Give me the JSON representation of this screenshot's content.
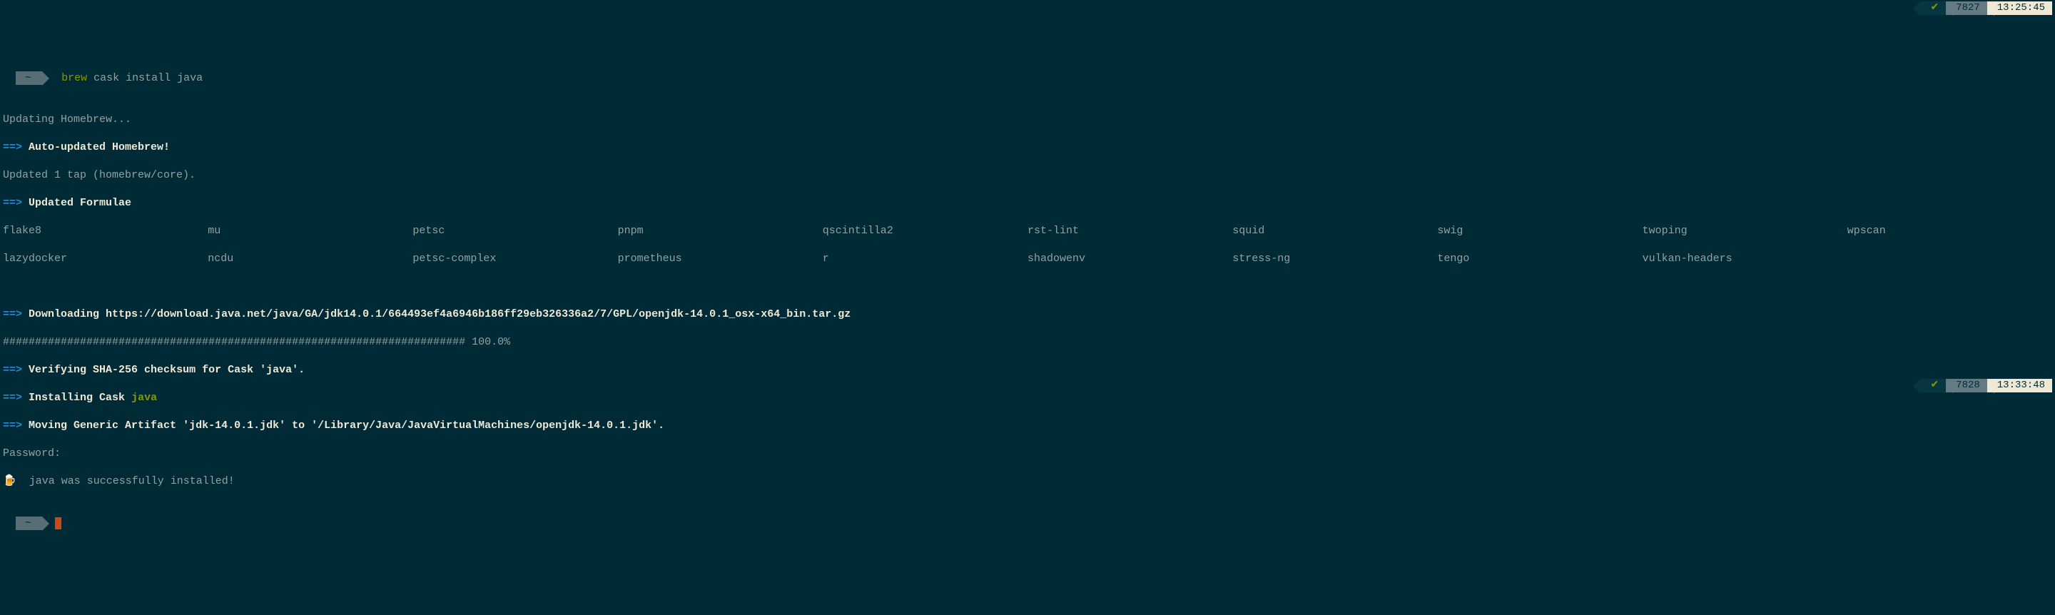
{
  "prompt": {
    "symbol": "~",
    "cmd_first": "brew",
    "cmd_rest": "cask install java"
  },
  "status1": {
    "check": "✔",
    "num": "7827",
    "time": "13:25:45"
  },
  "status2": {
    "check": "✔",
    "num": "7828",
    "time": "13:33:48"
  },
  "lines": {
    "updating": "Updating Homebrew...",
    "arrow": "==>",
    "auto_updated": "Auto-updated Homebrew!",
    "updated_tap": "Updated 1 tap (homebrew/core).",
    "updated_formulae": "Updated Formulae",
    "downloading": "Downloading https://download.java.net/java/GA/jdk14.0.1/664493ef4a6946b186ff29eb326336a2/7/GPL/openjdk-14.0.1_osx-x64_bin.tar.gz",
    "progress": "######################################################################## 100.0%",
    "verifying": "Verifying SHA-256 checksum for Cask 'java'.",
    "installing_pre": "Installing Cask ",
    "installing_name": "java",
    "moving": "Moving Generic Artifact 'jdk-14.0.1.jdk' to '/Library/Java/JavaVirtualMachines/openjdk-14.0.1.jdk'.",
    "password": "Password:",
    "success_emoji": "🍺",
    "success": "  java was successfully installed!"
  },
  "formulae": {
    "row1": [
      "flake8",
      "mu",
      "petsc",
      "pnpm",
      "qscintilla2",
      "rst-lint",
      "squid",
      "swig",
      "twoping",
      "wpscan"
    ],
    "row2": [
      "lazydocker",
      "ncdu",
      "petsc-complex",
      "prometheus",
      "r",
      "shadowenv",
      "stress-ng",
      "tengo",
      "vulkan-headers",
      ""
    ]
  }
}
